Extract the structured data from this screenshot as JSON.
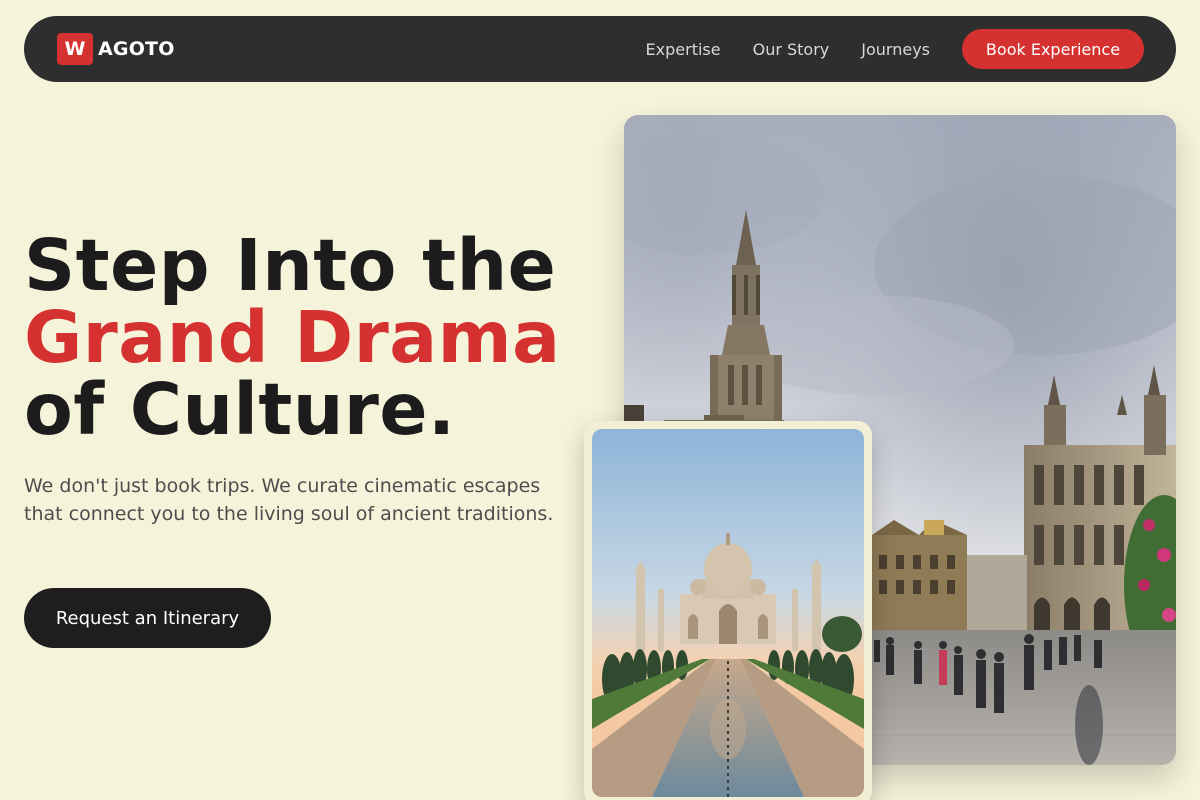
{
  "brand": {
    "badge": "W",
    "name": "AGOTO",
    "accent_color": "#d63131"
  },
  "nav": {
    "links": [
      {
        "label": "Expertise"
      },
      {
        "label": "Our Story"
      },
      {
        "label": "Journeys"
      }
    ],
    "cta_label": "Book Experience"
  },
  "hero": {
    "headline_line1": "Step Into the",
    "headline_line2": "Grand Drama",
    "headline_line3": "of Culture.",
    "subtext": "We don't just book trips. We curate cinematic escapes that connect you to the living soul of ancient traditions.",
    "cta_label": "Request an Itinerary"
  },
  "images": {
    "main": "grand-place-square-photo",
    "front": "taj-mahal-photo"
  },
  "colors": {
    "background": "#f5f4da",
    "navbar": "#2e2e2e",
    "text_dark": "#1c1c1c",
    "text_muted": "#4d4d4d",
    "button_dark": "#1e1e1e"
  }
}
